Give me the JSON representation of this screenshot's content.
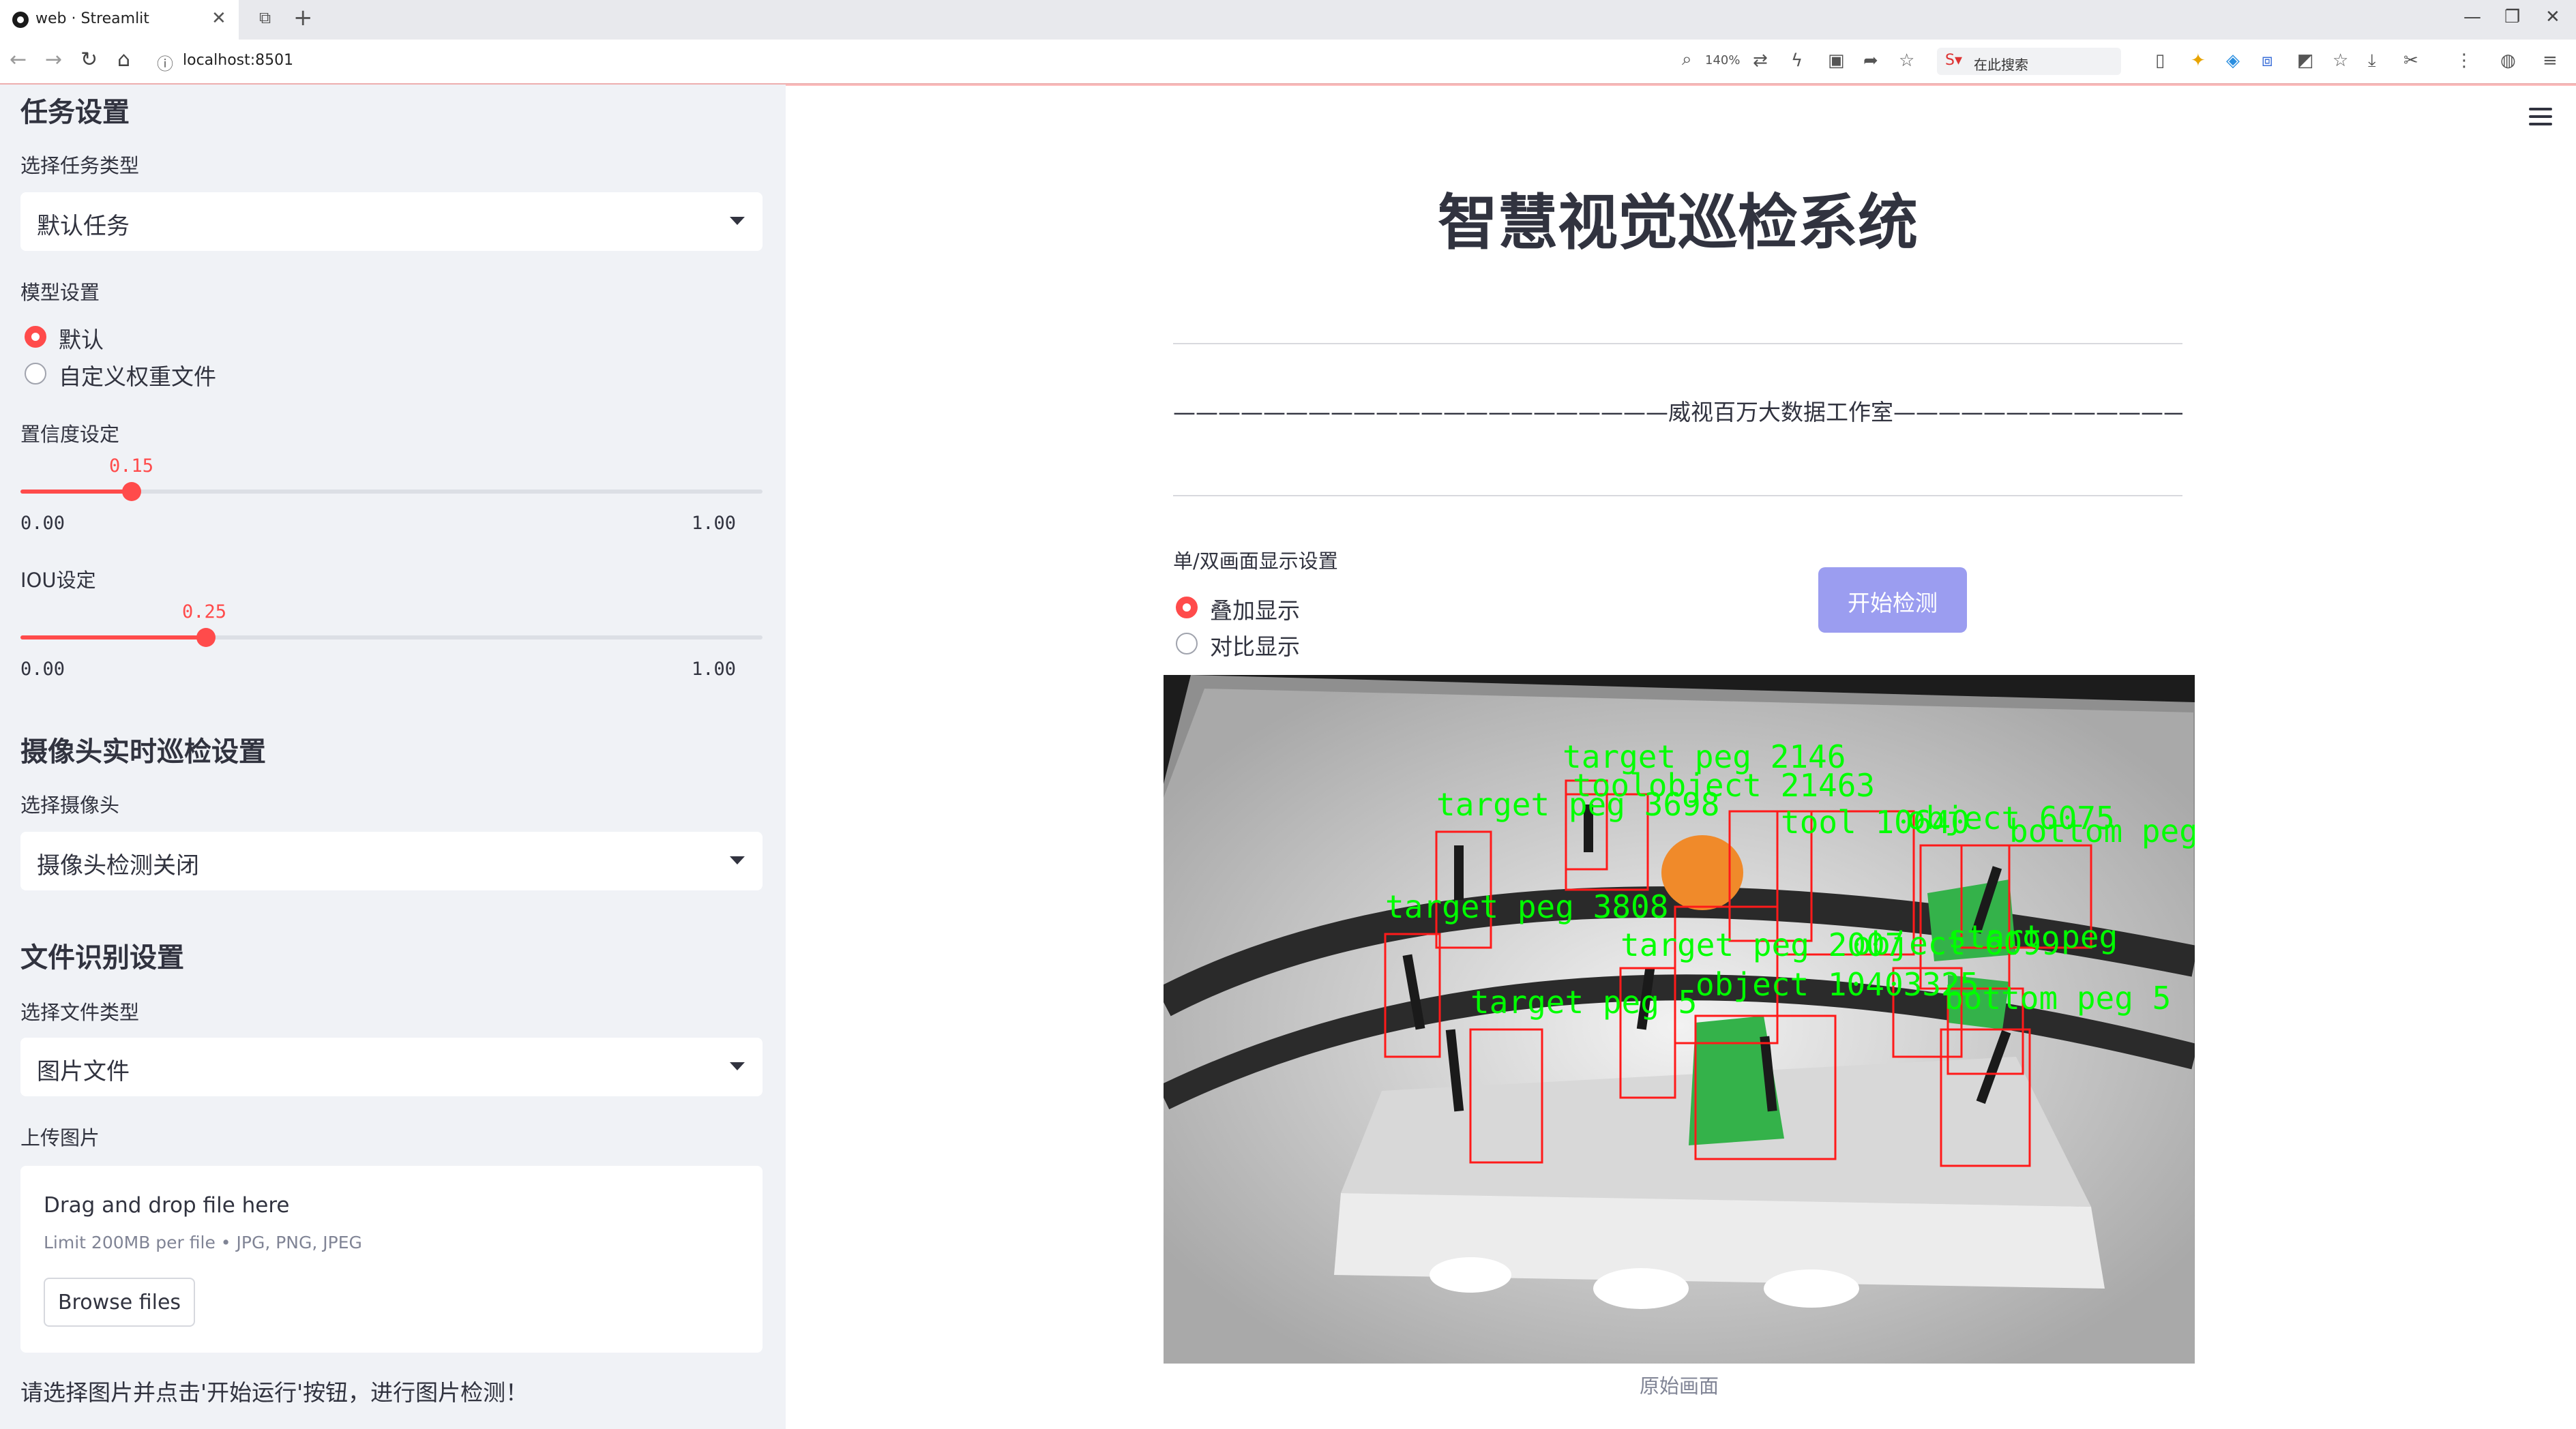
{
  "browser": {
    "tab_title": "web · Streamlit",
    "url": "localhost:8501",
    "zoom": "140%",
    "search_placeholder": "在此搜索"
  },
  "sidebar": {
    "task_section_title": "任务设置",
    "task_type_label": "选择任务类型",
    "task_type_value": "默认任务",
    "model_label": "模型设置",
    "model_options": [
      "默认",
      "自定义权重文件"
    ],
    "model_selected": "默认",
    "confidence_label": "置信度设定",
    "confidence": {
      "value": "0.15",
      "min": "0.00",
      "max": "1.00"
    },
    "iou_label": "IOU设定",
    "iou": {
      "value": "0.25",
      "min": "0.00",
      "max": "1.00"
    },
    "camera_section_title": "摄像头实时巡检设置",
    "camera_label": "选择摄像头",
    "camera_value": "摄像头检测关闭",
    "file_section_title": "文件识别设置",
    "file_type_label": "选择文件类型",
    "file_type_value": "图片文件",
    "upload_label": "上传图片",
    "uploader": {
      "drag_text": "Drag and drop file here",
      "limit_text": "Limit 200MB per file • JPG, PNG, JPEG",
      "browse_label": "Browse files"
    },
    "hint": "请选择图片并点击'开始运行'按钮，进行图片检测！"
  },
  "main": {
    "title": "智慧视觉巡检系统",
    "studio_line": "——————————————————————威视百万大数据工作室——————————————————————",
    "display_label": "单/双画面显示设置",
    "display_options": [
      "叠加显示",
      "对比显示"
    ],
    "display_selected": "叠加显示",
    "start_button": "开始检测",
    "image_caption": "原始画面",
    "detection_labels": [
      "target peg 2146",
      "toolobject 21463",
      "target peg 3698",
      "tool 10640",
      "object 6075",
      "bottom peg",
      "target peg 3808",
      "target peg 2007",
      "object 6099",
      "start peg",
      "object 10403325",
      "target peg 5",
      "bottom peg 5"
    ],
    "colors": {
      "accent": "#ff4b4b",
      "box": "#ff1a1a",
      "label": "#00ff00",
      "button": "#9b9df0"
    }
  }
}
